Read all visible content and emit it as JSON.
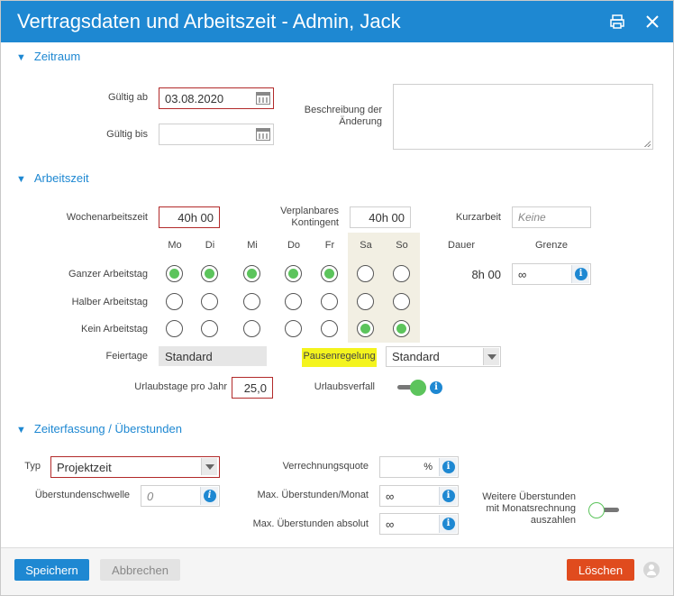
{
  "title": "Vertragsdaten und Arbeitszeit - Admin, Jack",
  "sections": {
    "zeitraum": "Zeitraum",
    "arbeitszeit": "Arbeitszeit",
    "zeiterfassung": "Zeiterfassung / Überstunden"
  },
  "zeitraum": {
    "gueltig_ab_label": "Gültig ab",
    "gueltig_ab_value": "03.08.2020",
    "gueltig_bis_label": "Gültig bis",
    "gueltig_bis_value": "",
    "beschreibung_label": "Beschreibung der Änderung",
    "beschreibung_value": ""
  },
  "arbeitszeit": {
    "wochenarbeitszeit_label": "Wochenarbeitszeit",
    "wochenarbeitszeit_value": "40h 00",
    "verplanbar_label": "Verplanbares Kontingent",
    "verplanbar_value": "40h 00",
    "kurzarbeit_label": "Kurzarbeit",
    "kurzarbeit_placeholder": "Keine",
    "days": [
      "Mo",
      "Di",
      "Mi",
      "Do",
      "Fr",
      "Sa",
      "So"
    ],
    "dauer_label": "Dauer",
    "grenze_label": "Grenze",
    "rows": [
      {
        "label": "Ganzer Arbeitstag",
        "selected": [
          true,
          true,
          true,
          true,
          true,
          false,
          false
        ]
      },
      {
        "label": "Halber Arbeitstag",
        "selected": [
          false,
          false,
          false,
          false,
          false,
          false,
          false
        ]
      },
      {
        "label": "Kein Arbeitstag",
        "selected": [
          false,
          false,
          false,
          false,
          false,
          true,
          true
        ]
      }
    ],
    "dauer_value": "8h 00",
    "grenze_value": "∞",
    "feiertage_label": "Feiertage",
    "feiertage_value": "Standard",
    "pausenregelung_label": "Pausenregelung",
    "pausenregelung_value": "Standard",
    "urlaubstage_label": "Urlaubstage pro Jahr",
    "urlaubstage_value": "25,0",
    "urlaubsverfall_label": "Urlaubsverfall",
    "urlaubsverfall_on": true
  },
  "zeiterfassung": {
    "typ_label": "Typ",
    "typ_value": "Projektzeit",
    "verrechnungsquote_label": "Verrechnungsquote",
    "verrechnungsquote_unit": "%",
    "ueberstundenschwelle_label": "Überstundenschwelle",
    "ueberstundenschwelle_placeholder": "0",
    "max_monat_label": "Max. Überstunden/Monat",
    "max_monat_value": "∞",
    "max_absolut_label": "Max. Überstunden absolut",
    "max_absolut_value": "∞",
    "weitere_label": "Weitere Überstunden mit Monatsrechnung auszahlen",
    "weitere_on": false
  },
  "footer": {
    "save": "Speichern",
    "cancel": "Abbrechen",
    "delete": "Löschen"
  },
  "icons": {
    "info": "i",
    "collapse": "▼"
  },
  "colors": {
    "brand": "#1e88d2",
    "error_border": "#b22a2a",
    "active_green": "#5cc45c",
    "highlight": "#f4f41e",
    "danger": "#e04b1e"
  }
}
